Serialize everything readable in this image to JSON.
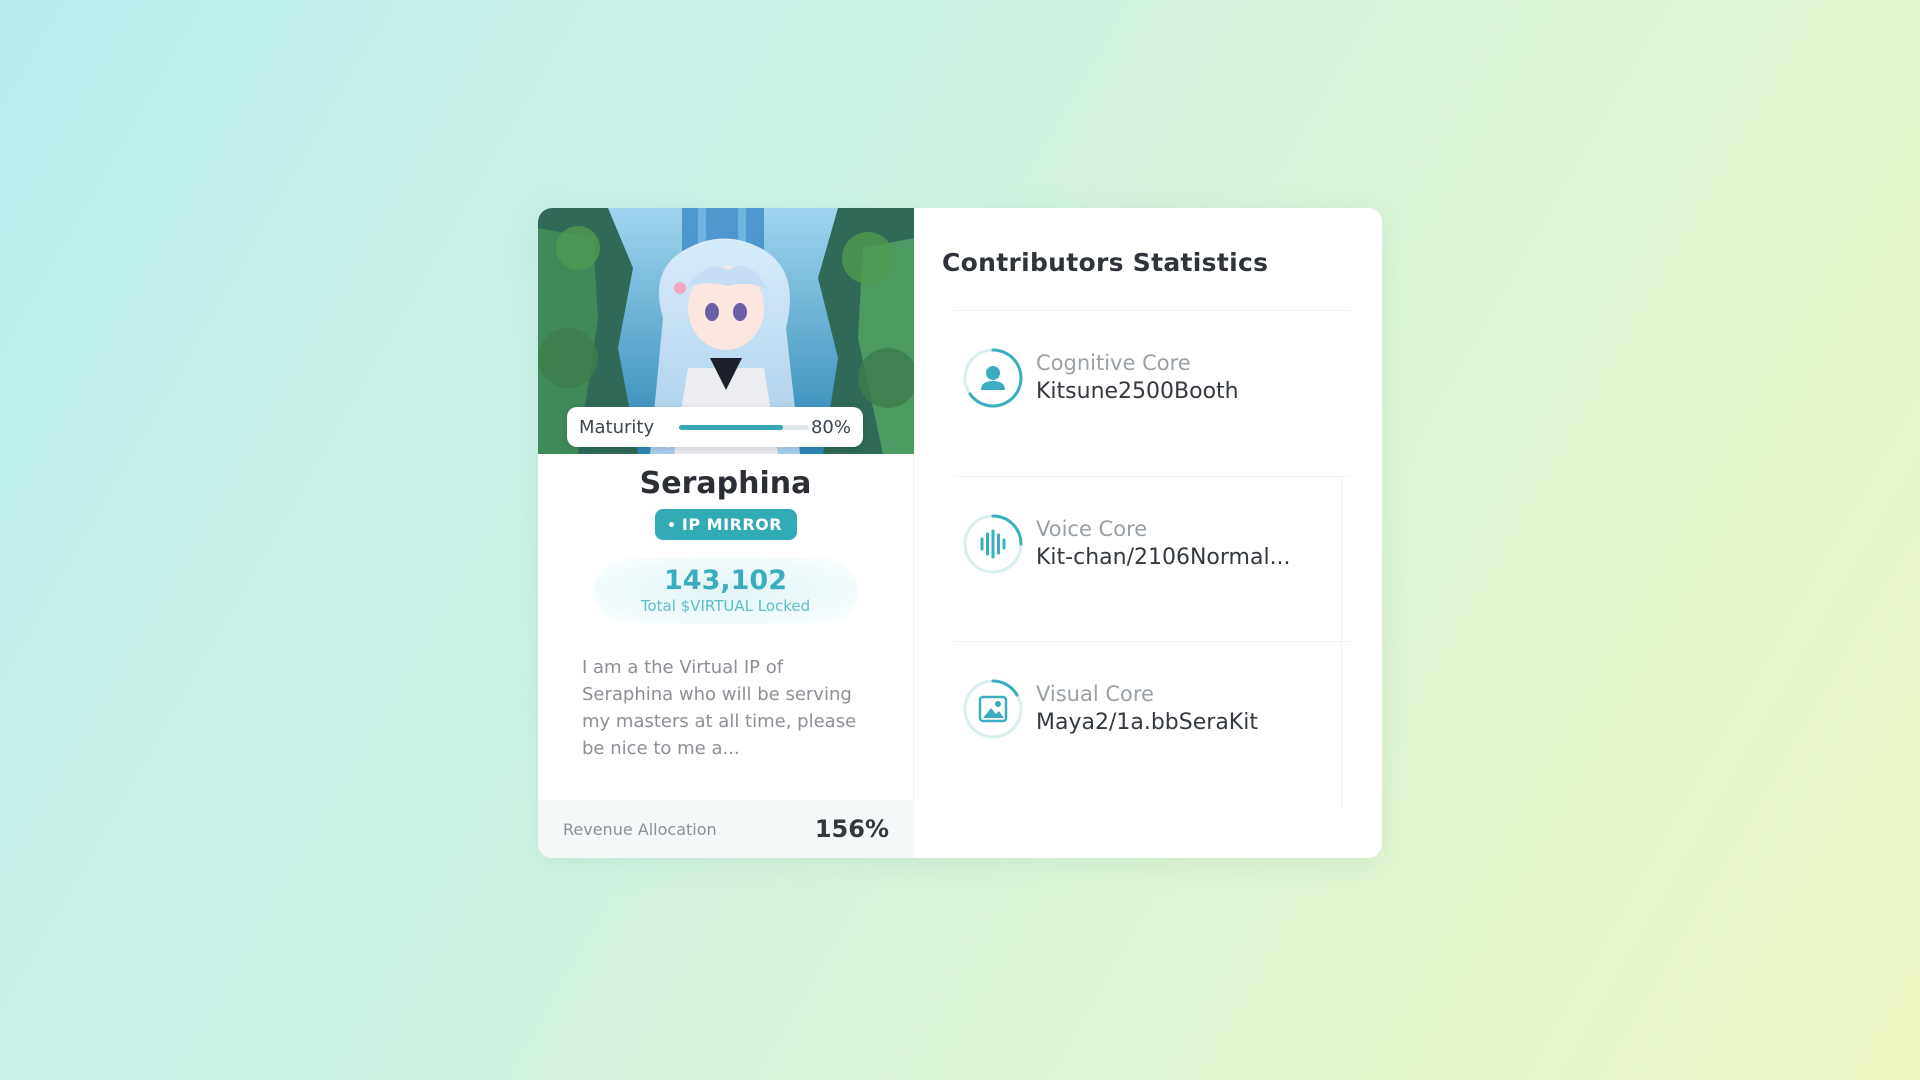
{
  "card": {
    "maturity": {
      "label": "Maturity",
      "value_text": "80%",
      "level": 0.8
    },
    "name": "Seraphina",
    "badge": "IP MIRROR",
    "locked": {
      "amount": "143,102",
      "caption": "Total $VIRTUAL Locked"
    },
    "description": "I am a the Virtual IP of Seraphina who will be serving my masters at all time, please be nice to me a...",
    "revenue": {
      "label": "Revenue Allocation",
      "value": "156%"
    }
  },
  "contributors": {
    "title": "Contributors Statistics",
    "items": [
      {
        "kind": "Cognitive Core",
        "value": "Kitsune2500Booth",
        "icon": "person-icon"
      },
      {
        "kind": "Voice Core",
        "value": "Kit-chan/2106Normal...",
        "icon": "waveform-icon"
      },
      {
        "kind": "Visual Core",
        "value": "Maya2/1a.bbSeraKit",
        "icon": "image-icon"
      }
    ]
  },
  "colors": {
    "accent": "#33abb7",
    "text_dark": "#2b2f35",
    "muted": "#9aa1a6"
  }
}
